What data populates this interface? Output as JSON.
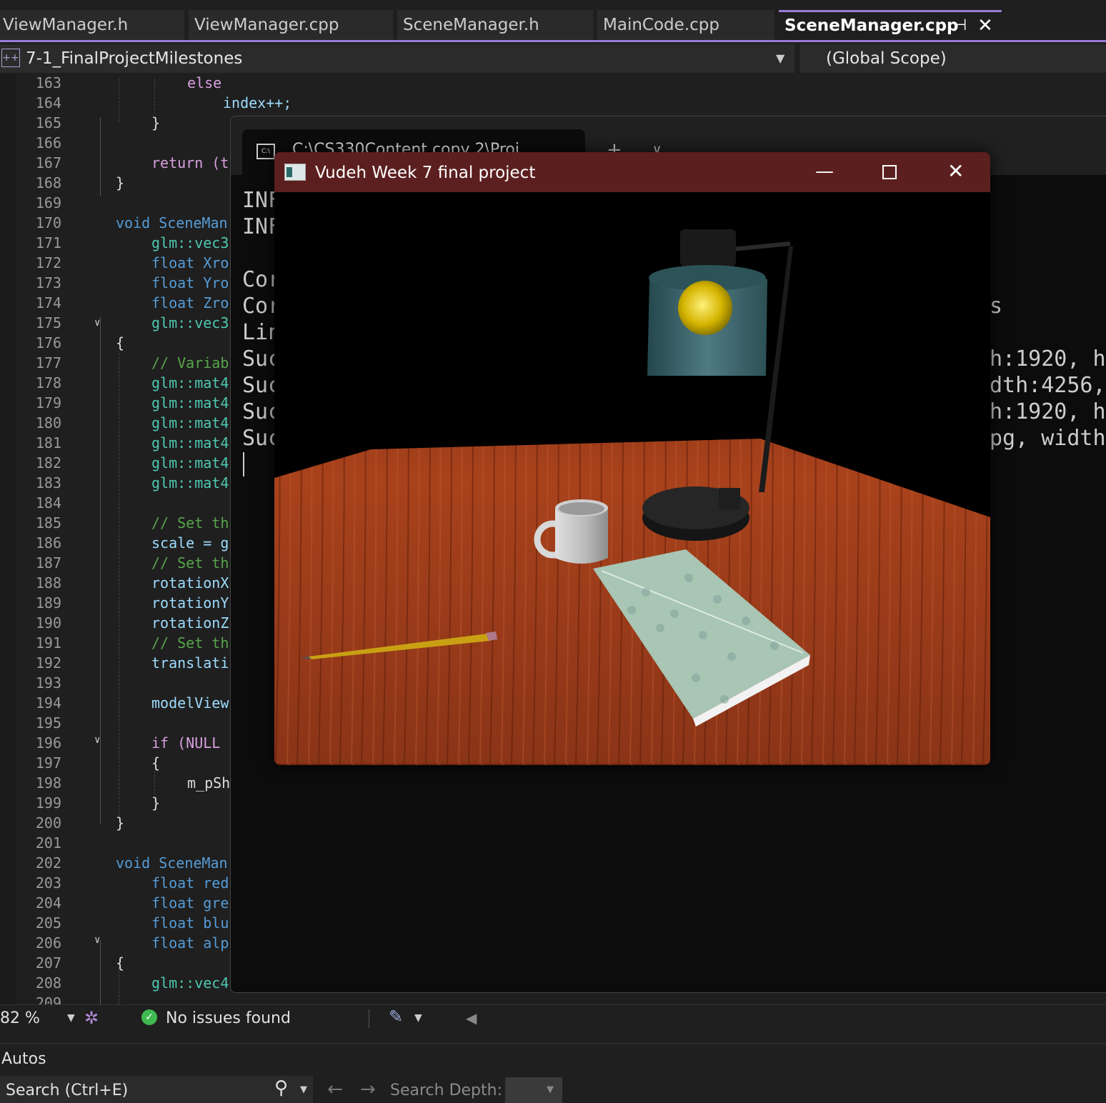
{
  "tabs": [
    {
      "label": "ViewManager.h"
    },
    {
      "label": "ViewManager.cpp"
    },
    {
      "label": "SceneManager.h"
    },
    {
      "label": "MainCode.cpp"
    },
    {
      "label": "SceneManager.cpp",
      "active": true
    }
  ],
  "nav": {
    "project": "7-1_FinalProjectMilestones",
    "scope": "(Global Scope)"
  },
  "editor": {
    "lines": [
      {
        "n": "163",
        "text": "else"
      },
      {
        "n": "164",
        "text": "index++;"
      },
      {
        "n": "165",
        "text": "}"
      },
      {
        "n": "166",
        "text": ""
      },
      {
        "n": "167",
        "text": "return (t"
      },
      {
        "n": "168",
        "text": "}"
      },
      {
        "n": "169",
        "text": ""
      },
      {
        "n": "170",
        "text": "void SceneMan"
      },
      {
        "n": "171",
        "text": "glm::vec3"
      },
      {
        "n": "172",
        "text": "float Xro"
      },
      {
        "n": "173",
        "text": "float Yro"
      },
      {
        "n": "174",
        "text": "float Zro"
      },
      {
        "n": "175",
        "text": "glm::vec3"
      },
      {
        "n": "176",
        "text": "{"
      },
      {
        "n": "177",
        "text": "// Variab"
      },
      {
        "n": "178",
        "text": "glm::mat4"
      },
      {
        "n": "179",
        "text": "glm::mat4"
      },
      {
        "n": "180",
        "text": "glm::mat4"
      },
      {
        "n": "181",
        "text": "glm::mat4"
      },
      {
        "n": "182",
        "text": "glm::mat4"
      },
      {
        "n": "183",
        "text": "glm::mat4"
      },
      {
        "n": "184",
        "text": ""
      },
      {
        "n": "185",
        "text": "// Set th"
      },
      {
        "n": "186",
        "text": "scale = g"
      },
      {
        "n": "187",
        "text": "// Set th"
      },
      {
        "n": "188",
        "text": "rotationX"
      },
      {
        "n": "189",
        "text": "rotationY"
      },
      {
        "n": "190",
        "text": "rotationZ"
      },
      {
        "n": "191",
        "text": "// Set th"
      },
      {
        "n": "192",
        "text": "translati"
      },
      {
        "n": "193",
        "text": ""
      },
      {
        "n": "194",
        "text": "modelView"
      },
      {
        "n": "195",
        "text": ""
      },
      {
        "n": "196",
        "text": "if (NULL"
      },
      {
        "n": "197",
        "text": "{"
      },
      {
        "n": "198",
        "text": "m_pSh"
      },
      {
        "n": "199",
        "text": "}"
      },
      {
        "n": "200",
        "text": "}"
      },
      {
        "n": "201",
        "text": ""
      },
      {
        "n": "202",
        "text": "void SceneMan"
      },
      {
        "n": "203",
        "text": "float red"
      },
      {
        "n": "204",
        "text": "float gre"
      },
      {
        "n": "205",
        "text": "float blu"
      },
      {
        "n": "206",
        "text": "float alp"
      },
      {
        "n": "207",
        "text": "{"
      },
      {
        "n": "208",
        "text": "glm::vec4"
      },
      {
        "n": "209",
        "text": ""
      }
    ]
  },
  "console": {
    "tab_title": "C:\\CS330Content copy 2\\Proj",
    "left_lines": [
      "INF",
      "INF",
      "",
      "Cor",
      "Cor",
      "Lin",
      "Suc",
      "Suc",
      "Suc",
      "Suc"
    ],
    "right_lines": [
      "s",
      "",
      "h:1920, h",
      "dth:4256,",
      "h:1920, h",
      "pg, width"
    ]
  },
  "glwindow": {
    "title": "Vudeh Week 7 final project"
  },
  "status": {
    "zoom": "82 %",
    "issues": "No issues found"
  },
  "autos": {
    "title": "Autos",
    "search_placeholder": "Search (Ctrl+E)",
    "search_depth_label": "Search Depth:"
  },
  "colors": {
    "accent": "#9a7bd8",
    "gl_titlebar": "#5c1f1f",
    "ok_green": "#3fb950"
  }
}
